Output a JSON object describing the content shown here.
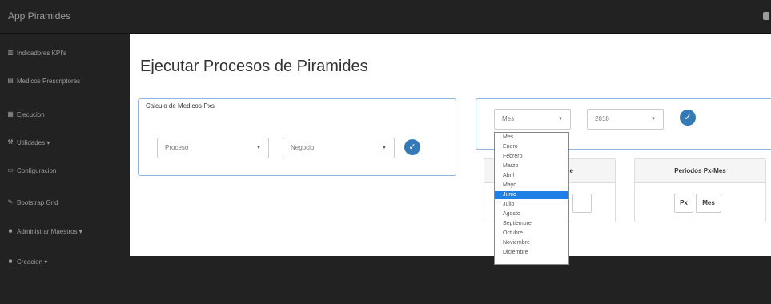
{
  "app": {
    "brand": "App Piramides"
  },
  "sidebar": {
    "items": [
      {
        "label": "Indicadores KPI's",
        "icon": "bar-chart-icon"
      },
      {
        "label": "Medicos Prescriptores",
        "icon": "users-table-icon"
      },
      {
        "label": "Ejecucion",
        "icon": "grid-icon"
      },
      {
        "label": "Utilidades ▾",
        "icon": "wrench-icon"
      },
      {
        "label": "Configuracion",
        "icon": "monitor-icon"
      },
      {
        "label": "Bootstrap Grid",
        "icon": "wrench-tool-icon"
      },
      {
        "label": "Administrar Maestros ▾",
        "icon": "file-icon"
      },
      {
        "label": "Creacion ▾",
        "icon": "file-icon"
      }
    ]
  },
  "main": {
    "title": "Ejecutar Procesos de Piramides",
    "panel_left": {
      "heading": "Calculo de Medicos-Pxs",
      "select_proceso": "Proceso",
      "select_negocio": "Negocio"
    },
    "panel_right": {
      "select_mes": "Mes",
      "select_anio": "2018",
      "subpanel_left_heading": "ide",
      "subpanel_right_heading": "Periodos Px-Mes",
      "btn_px": "Px",
      "btn_mes": "Mes"
    },
    "month_dropdown": {
      "options": [
        "Mes",
        "Enero",
        "Febrero",
        "Marzo",
        "Abril",
        "Mayo",
        "Junio",
        "Julio",
        "Agosto",
        "Septiembre",
        "Octubre",
        "Noviembre",
        "Diciembre"
      ],
      "highlighted": "Junio"
    }
  },
  "colors": {
    "navbar": "#222222",
    "panel_border": "#8fb6dc",
    "primary": "#337ab7",
    "highlight": "#1e7fe6"
  }
}
